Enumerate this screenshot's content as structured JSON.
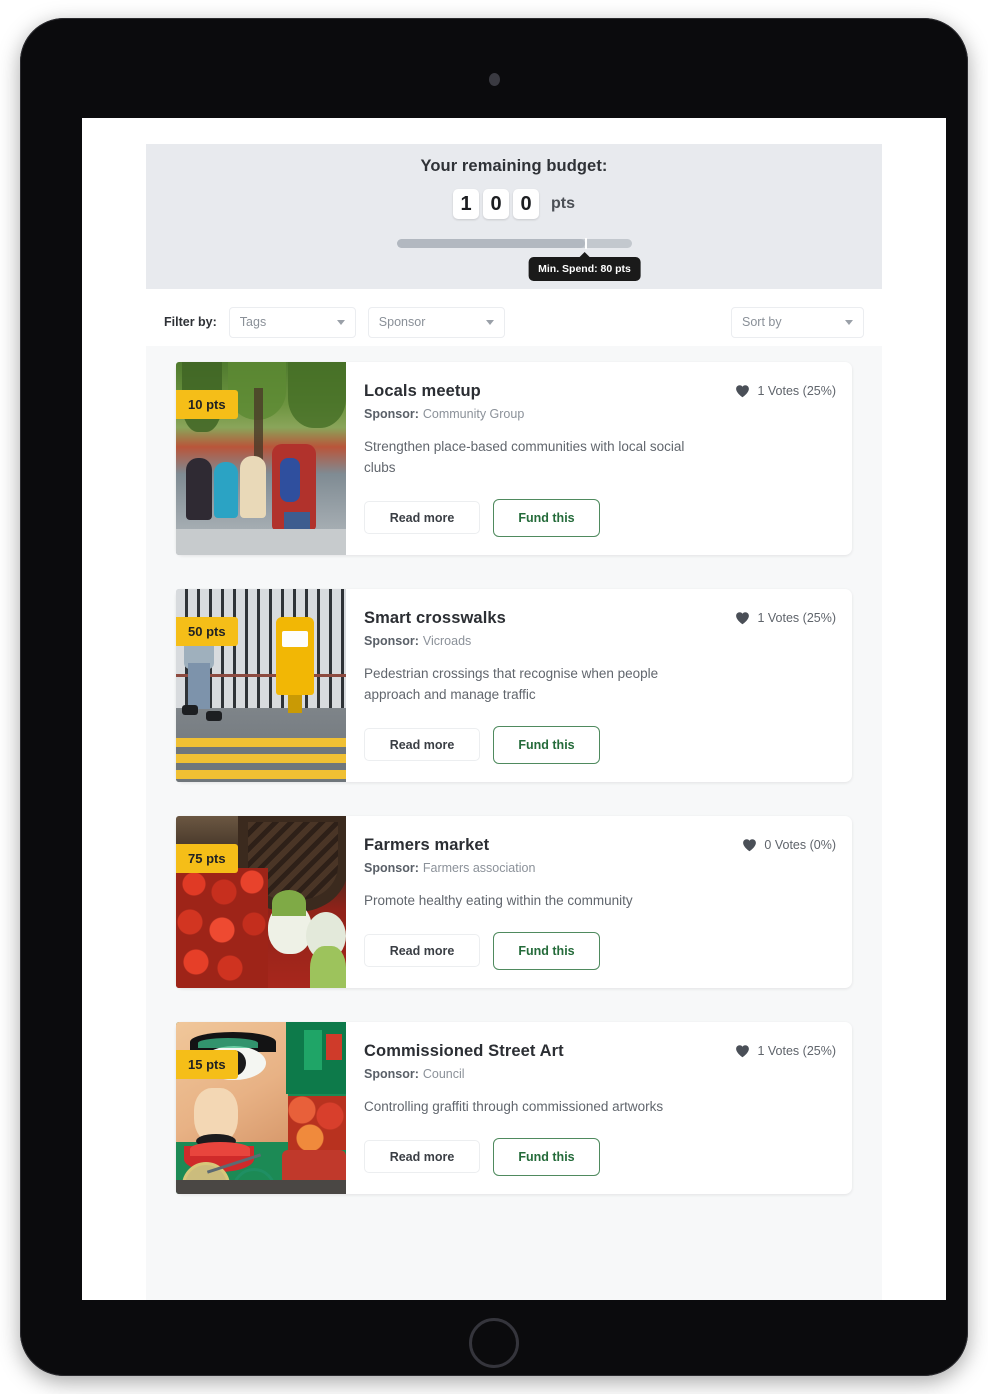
{
  "device": {
    "camera_icon": "camera-dot-icon",
    "home_button_icon": "home-button-icon"
  },
  "budget": {
    "title": "Your remaining budget:",
    "digits": [
      "1",
      "0",
      "0"
    ],
    "unit": "pts",
    "slider": {
      "fill_percent": 80,
      "tick_percent": 80
    },
    "tooltip": "Min. Spend: 80 pts"
  },
  "filters": {
    "label": "Filter by:",
    "tags": {
      "placeholder": "Tags",
      "caret_icon": "chevron-down-icon"
    },
    "sponsor": {
      "placeholder": "Sponsor",
      "caret_icon": "chevron-down-icon"
    },
    "sort": {
      "placeholder": "Sort by",
      "caret_icon": "chevron-down-icon"
    }
  },
  "buttons": {
    "read_more": "Read more",
    "fund_this": "Fund this"
  },
  "labels": {
    "sponsor_key": "Sponsor:"
  },
  "colors": {
    "badge": "#f5be18",
    "fund_border": "#4f8a5e",
    "fund_text": "#246b3a",
    "header_bg": "#e8eaee",
    "list_bg": "#f7f8f9",
    "tooltip_bg": "#1a1a1a"
  },
  "proposals": [
    {
      "points": "10 pts",
      "title": "Locals meetup",
      "sponsor": "Community Group",
      "description": "Strengthen place-based communities with local social clubs",
      "votes": "1 Votes (25%)",
      "image_alt": "people sitting outdoors by trees"
    },
    {
      "points": "50 pts",
      "title": "Smart crosswalks",
      "sponsor": "Vicroads",
      "description": "Pedestrian crossings that recognise when people approach and manage traffic",
      "votes": "1 Votes (25%)",
      "image_alt": "person walking across a yellow crosswalk"
    },
    {
      "points": "75 pts",
      "title": "Farmers market",
      "sponsor": "Farmers association",
      "description": "Promote healthy eating within the community",
      "votes": "0 Votes (0%)",
      "image_alt": "tomatoes and vegetables in a basket"
    },
    {
      "points": "15 pts",
      "title": "Commissioned Street Art",
      "sponsor": "Council",
      "description": "Controlling graffiti through commissioned artworks",
      "votes": "1 Votes (25%)",
      "image_alt": "colorful street art mural with a face"
    }
  ]
}
